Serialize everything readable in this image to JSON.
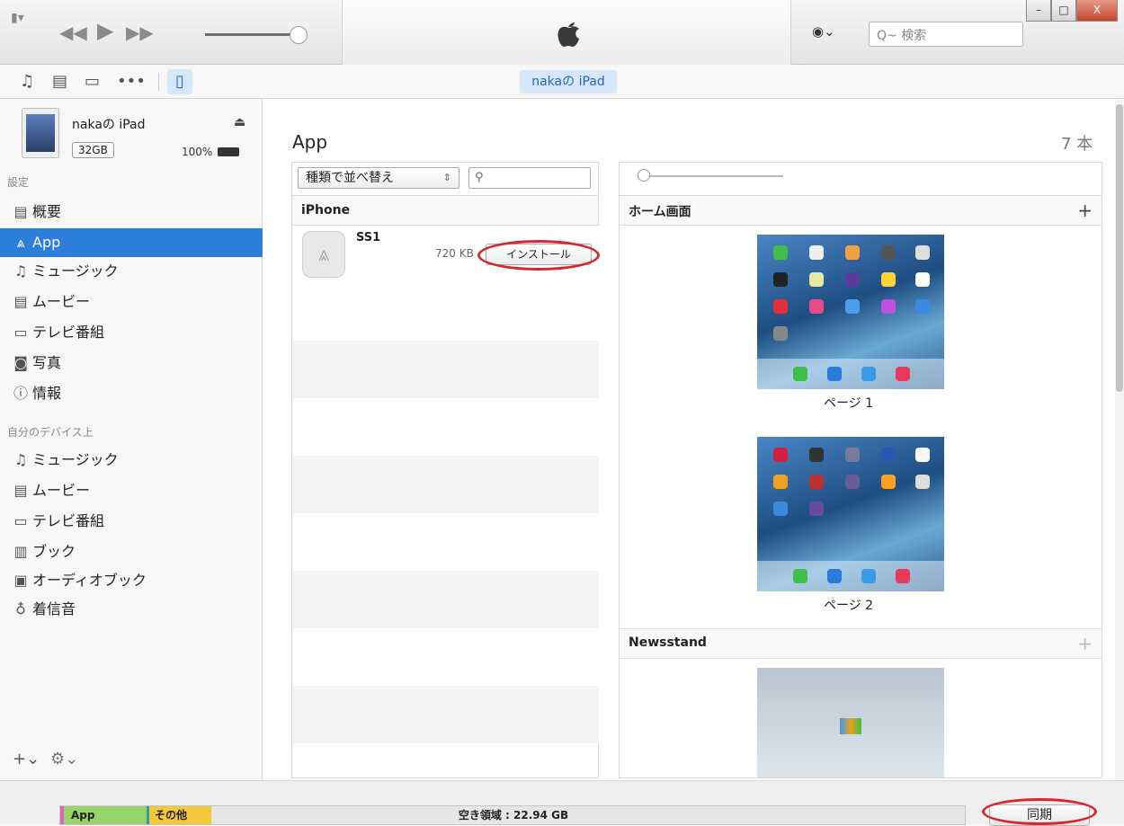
{
  "topbar": {
    "search_placeholder": "Q~ 検索",
    "window_buttons": [
      "–",
      "□",
      "X"
    ]
  },
  "toolbar": {
    "device_tab": "nakaの iPad"
  },
  "device": {
    "name": "nakaの iPad",
    "capacity": "32GB",
    "battery": "100%"
  },
  "sidebar": {
    "settings_header": "設定",
    "settings_items": [
      {
        "label": "概要",
        "icon": "summary-icon"
      },
      {
        "label": "App",
        "icon": "app-icon"
      },
      {
        "label": "ミュージック",
        "icon": "music-icon"
      },
      {
        "label": "ムービー",
        "icon": "movie-icon"
      },
      {
        "label": "テレビ番組",
        "icon": "tv-icon"
      },
      {
        "label": "写真",
        "icon": "camera-icon"
      },
      {
        "label": "情報",
        "icon": "info-icon"
      }
    ],
    "ondevice_header": "自分のデバイス上",
    "ondevice_items": [
      {
        "label": "ミュージック",
        "icon": "music-icon"
      },
      {
        "label": "ムービー",
        "icon": "movie-icon"
      },
      {
        "label": "テレビ番組",
        "icon": "tv-icon"
      },
      {
        "label": "ブック",
        "icon": "book-icon"
      },
      {
        "label": "オーディオブック",
        "icon": "audiobook-icon"
      },
      {
        "label": "着信音",
        "icon": "bell-icon"
      }
    ],
    "selected": "App"
  },
  "main": {
    "title": "App",
    "count": "7 本",
    "sort_select": "種類で並べ替え",
    "list_header": "iPhone",
    "apps": [
      {
        "name": "SS1",
        "size": "720 KB",
        "action": "インストール"
      }
    ],
    "home_header": "ホーム画面",
    "pages": [
      "ページ 1",
      "ページ 2"
    ],
    "newsstand_header": "Newsstand",
    "plus": "+"
  },
  "bottom": {
    "seg_app": "App",
    "seg_other": "その他",
    "free_space": "空き領域 : 22.94 GB",
    "sync": "同期"
  },
  "colors": {
    "accent": "#2e7fd9",
    "highlight_ellipse": "#d7262c",
    "app_segment": "#96d46a",
    "other_segment": "#f4c63a"
  }
}
